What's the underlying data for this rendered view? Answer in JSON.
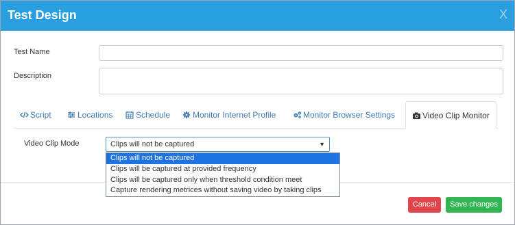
{
  "modal": {
    "title": "Test Design",
    "close_label": "X"
  },
  "form": {
    "test_name_label": "Test Name",
    "test_name_value": "",
    "description_label": "Description",
    "description_value": ""
  },
  "tabs": [
    {
      "label": "Script",
      "icon": "code-icon"
    },
    {
      "label": "Locations",
      "icon": "sliders-icon"
    },
    {
      "label": "Schedule",
      "icon": "calendar-icon"
    },
    {
      "label": "Monitor Internet Profile",
      "icon": "gear-icon"
    },
    {
      "label": "Monitor Browser Settings",
      "icon": "gears-icon"
    },
    {
      "label": "Video Clip Monitor",
      "icon": "camera-icon",
      "active": true
    }
  ],
  "video_clip": {
    "mode_label": "Video Clip Mode",
    "selected_value": "Clips will not be captured",
    "options": [
      "Clips will not be captured",
      "Clips will be captured at provided frequency",
      "Clips will be captured only when threshold condition meet",
      "Capture rendering metrices without saving video by taking clips"
    ]
  },
  "footer": {
    "cancel_label": "Cancel",
    "save_label": "Save changes"
  },
  "colors": {
    "header": "#2a9fe0",
    "tab_link": "#3d7bb3",
    "cancel": "#e0454b",
    "save": "#33b553",
    "option_selected": "#1e73e0"
  }
}
